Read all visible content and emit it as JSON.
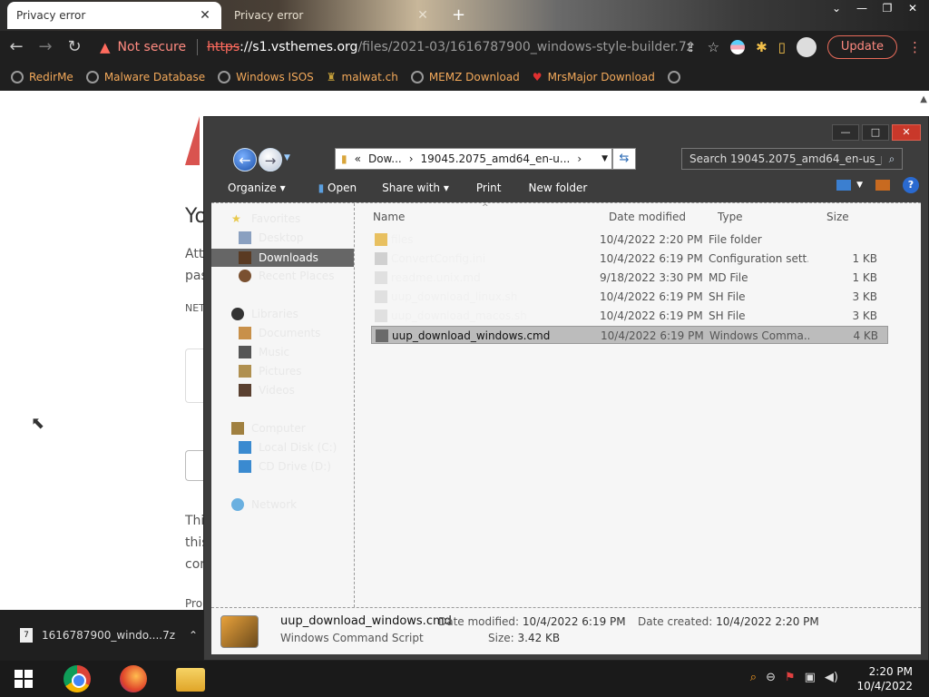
{
  "browser": {
    "tabs": [
      {
        "title": "Privacy error",
        "active": true
      },
      {
        "title": "Privacy error",
        "active": false
      }
    ],
    "omnibox": {
      "security_label": "Not secure",
      "url_scheme": "https",
      "url_host": "://s1.vsthemes.org",
      "url_path": "/files/2021-03/1616787900_windows-style-builder.7z"
    },
    "update_label": "Update",
    "bookmarks": [
      {
        "label": "RedirMe"
      },
      {
        "label": "Malware Database"
      },
      {
        "label": "Windows ISOS"
      },
      {
        "label": "malwat.ch"
      },
      {
        "label": "MEMZ Download"
      },
      {
        "label": "MrsMajor Download"
      }
    ],
    "download_item": "1616787900_windo....7z",
    "download_icon_text": "7"
  },
  "page_behind": {
    "heading_fragment": "Yo",
    "text_fragments": [
      "Att",
      "pas",
      "NET",
      "Thi",
      "this",
      "cor",
      "Pro"
    ]
  },
  "explorer": {
    "breadcrumb": [
      "Dow...",
      "19045.2075_amd64_en-u..."
    ],
    "search_placeholder": "Search 19045.2075_amd64_en-us_prof...",
    "commands": [
      "Organize",
      "Open",
      "Share with",
      "Print",
      "New folder"
    ],
    "nav": {
      "favorites": "Favorites",
      "desktop": "Desktop",
      "downloads": "Downloads",
      "recent": "Recent Places",
      "libraries": "Libraries",
      "documents": "Documents",
      "music": "Music",
      "pictures": "Pictures",
      "videos": "Videos",
      "computer": "Computer",
      "local_disk": "Local Disk (C:)",
      "dvd_drive": "CD Drive (D:)",
      "network": "Network"
    },
    "columns": {
      "name": "Name",
      "date": "Date modified",
      "type": "Type",
      "size": "Size"
    },
    "files": [
      {
        "name": "files",
        "date": "10/4/2022 2:20 PM",
        "type": "File folder",
        "size": ""
      },
      {
        "name": "ConvertConfig.ini",
        "date": "10/4/2022 6:19 PM",
        "type": "Configuration sett...",
        "size": "1 KB"
      },
      {
        "name": "readme.unix.md",
        "date": "9/18/2022 3:30 PM",
        "type": "MD File",
        "size": "1 KB"
      },
      {
        "name": "uup_download_linux.sh",
        "date": "10/4/2022 6:19 PM",
        "type": "SH File",
        "size": "3 KB"
      },
      {
        "name": "uup_download_macos.sh",
        "date": "10/4/2022 6:19 PM",
        "type": "SH File",
        "size": "3 KB"
      },
      {
        "name": "uup_download_windows.cmd",
        "date": "10/4/2022 6:19 PM",
        "type": "Windows Comma...",
        "size": "4 KB"
      }
    ],
    "details": {
      "name": "uup_download_windows.cmd",
      "kind": "Windows Command Script",
      "modified_label": "Date modified:",
      "modified": "10/4/2022 6:19 PM",
      "created_label": "Date created:",
      "created": "10/4/2022 2:20 PM",
      "size_label": "Size:",
      "size": "3.42 KB"
    }
  },
  "taskbar": {
    "time": "2:20 PM",
    "date": "10/4/2022"
  }
}
